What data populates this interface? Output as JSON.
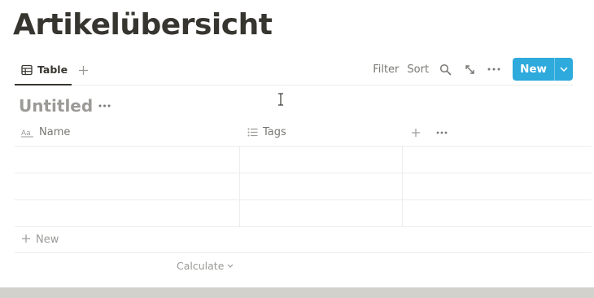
{
  "page": {
    "title": "Artikelübersicht"
  },
  "viewbar": {
    "active_view": "Table",
    "tools": {
      "filter": "Filter",
      "sort": "Sort"
    },
    "new_button": "New"
  },
  "database": {
    "title": "Untitled"
  },
  "table": {
    "columns": [
      {
        "label": "Name",
        "icon": "title-property-icon"
      },
      {
        "label": "Tags",
        "icon": "multi-select-list-icon"
      }
    ],
    "rows": [
      {
        "name": "",
        "tags": ""
      },
      {
        "name": "",
        "tags": ""
      },
      {
        "name": "",
        "tags": ""
      }
    ],
    "new_row_label": "New",
    "calculate_label": "Calculate"
  },
  "colors": {
    "accent_button": "#2eaadc",
    "text_primary": "#37352f",
    "text_muted": "#9b9a97",
    "divider": "#ededec",
    "bottom_bar": "#d3d1cb"
  }
}
